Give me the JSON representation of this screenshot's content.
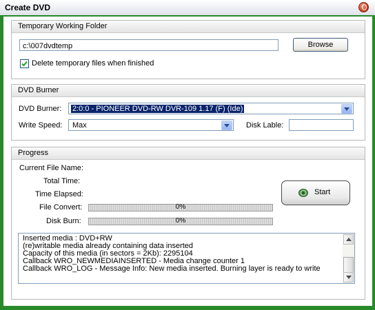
{
  "window": {
    "title": "Create DVD"
  },
  "working_folder": {
    "heading": "Temporary Working Folder",
    "path_value": "c:\\007dvdtemp",
    "browse_label": "Browse",
    "delete_temp_label": "Delete temporary files when finished",
    "delete_temp_checked": true
  },
  "burner": {
    "heading": "DVD Burner",
    "burner_label": "DVD Burner:",
    "burner_value": "2:0:0 - PIONEER DVD-RW  DVR-109 1.17 (F) (Ide)",
    "speed_label": "Write Speed:",
    "speed_value": "Max",
    "disk_label_label": "Disk Lable:",
    "disk_label_value": ""
  },
  "progress": {
    "heading": "Progress",
    "current_file_label": "Current File Name:",
    "total_time_label": "Total Time:",
    "time_elapsed_label": "Time Elapsed:",
    "file_convert_label": "File Convert:",
    "file_convert_percent": 0,
    "file_convert_text": "0%",
    "disk_burn_label": "Disk Burn:",
    "disk_burn_percent": 0,
    "disk_burn_text": "0%",
    "start_label": "Start",
    "log": [
      "Inserted media : DVD+RW",
      "(re)writable media already containing data inserted",
      "Capacity of this media (in sectors = 2Kb): 2295104",
      "Callback WRO_NEWMEDIAINSERTED - Media change counter 1",
      "Callback WRO_LOG - Message Info: New media inserted. Burning layer is ready to write"
    ]
  },
  "colors": {
    "frame": "#27892a",
    "selection": "#0a246a",
    "progress_fill": "#2f8d2f"
  }
}
